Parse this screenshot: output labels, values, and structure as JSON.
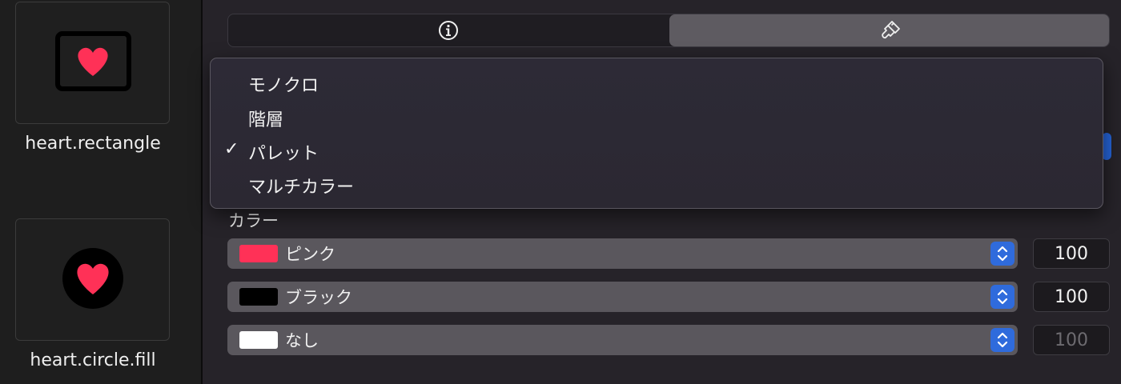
{
  "gallery": {
    "items": [
      {
        "label": "heart.rectangle"
      },
      {
        "label": "heart.circle.fill"
      }
    ]
  },
  "inspector": {
    "tabs": [
      {
        "icon": "info-icon"
      },
      {
        "icon": "paintbrush-icon"
      }
    ],
    "rendering_menu": {
      "options": [
        {
          "label": "モノクロ",
          "selected": false
        },
        {
          "label": "階層",
          "selected": false
        },
        {
          "label": "パレット",
          "selected": true
        },
        {
          "label": "マルチカラー",
          "selected": false
        }
      ],
      "check_mark": "✓"
    },
    "colors_label": "カラー",
    "colors": [
      {
        "name": "ピンク",
        "swatch": "#ff3157",
        "opacity": "100",
        "enabled": true
      },
      {
        "name": "ブラック",
        "swatch": "#000000",
        "opacity": "100",
        "enabled": true
      },
      {
        "name": "なし",
        "swatch": "#ffffff",
        "opacity": "100",
        "enabled": false
      }
    ]
  },
  "theme": {
    "accent": "#2f6bdc",
    "heart": "#ff3157"
  }
}
